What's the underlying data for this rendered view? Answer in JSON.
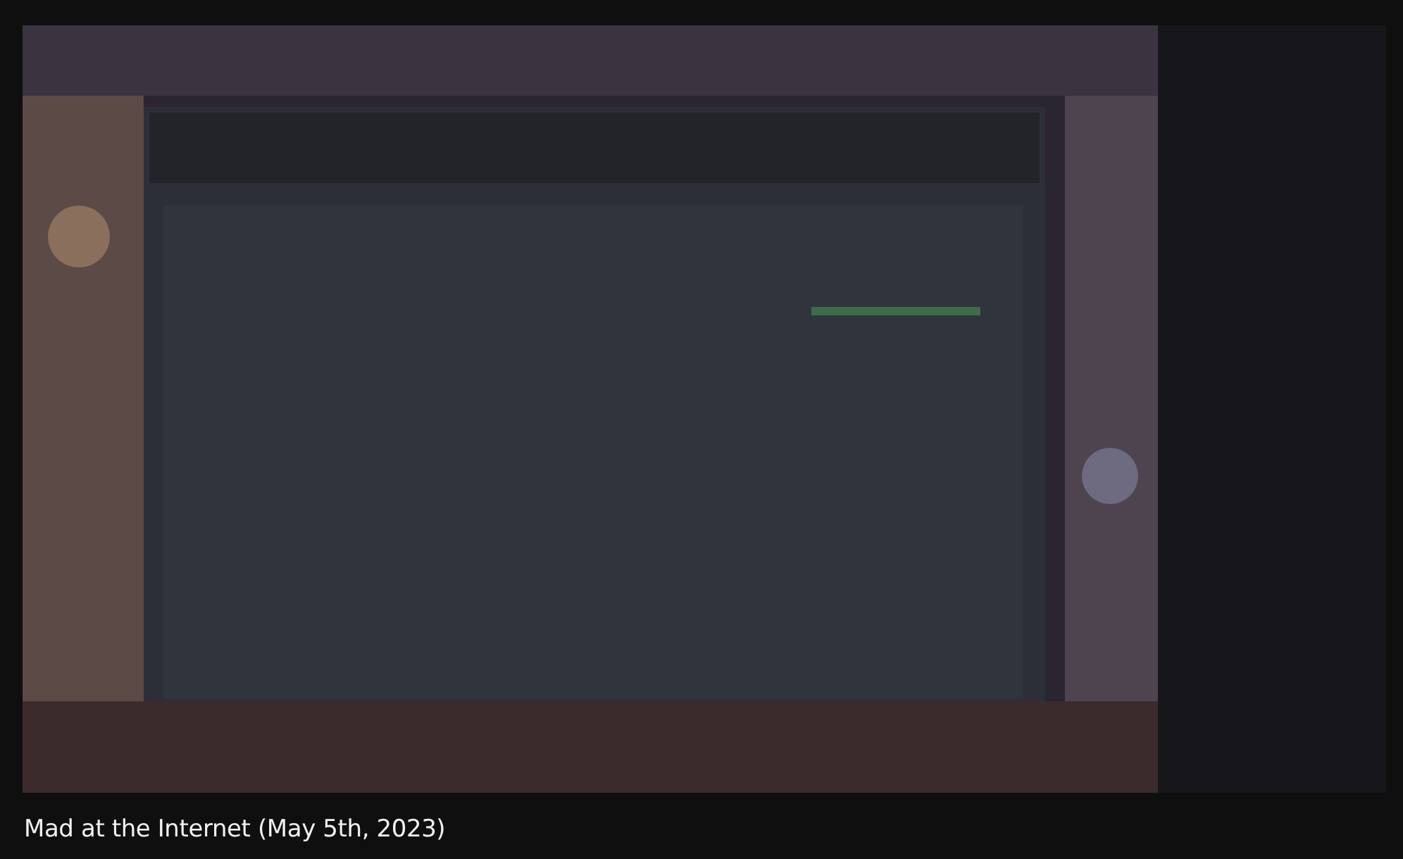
{
  "title": "Mad at the Internet (May 5th, 2023)"
}
